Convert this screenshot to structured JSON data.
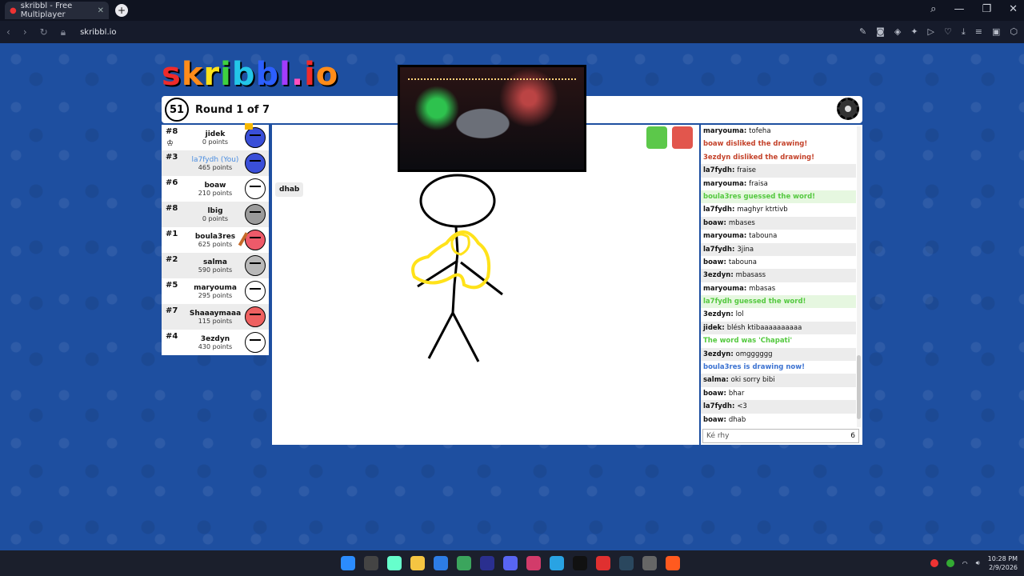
{
  "browser": {
    "tab_title": "skribbl - Free Multiplayer",
    "url": "skribbl.io",
    "new_tab": "+",
    "win_min": "—",
    "win_max": "❐",
    "win_close": "✕"
  },
  "game": {
    "logo_letters": [
      "s",
      "k",
      "r",
      "i",
      "b",
      "b",
      "l",
      ".",
      "i",
      "o"
    ],
    "timer": "51",
    "round_text": "Round 1 of 7"
  },
  "players": [
    {
      "rank": "#8",
      "name": "jidek",
      "points": "0 points",
      "color": "#3a4fd8"
    },
    {
      "rank": "#3",
      "name": "la7fydh (You)",
      "points": "465 points",
      "color": "#3a4fd8"
    },
    {
      "rank": "#6",
      "name": "boaw",
      "points": "210 points",
      "color": "#ffffff"
    },
    {
      "rank": "#8",
      "name": "lbig",
      "points": "0 points",
      "color": "#9a9a9a"
    },
    {
      "rank": "#1",
      "name": "boula3res",
      "points": "625 points",
      "color": "#ee5a6a"
    },
    {
      "rank": "#2",
      "name": "salma",
      "points": "590 points",
      "color": "#b8b8b8"
    },
    {
      "rank": "#5",
      "name": "maryouma",
      "points": "295 points",
      "color": "#ffffff"
    },
    {
      "rank": "#7",
      "name": "Shaaaymaaa",
      "points": "115 points",
      "color": "#ee6060"
    },
    {
      "rank": "#4",
      "name": "3ezdyn",
      "points": "430 points",
      "color": "#ffffff"
    }
  ],
  "bubble_text": "dhab",
  "chat": [
    {
      "user": "maryouma",
      "text": "tofeha",
      "type": "normal"
    },
    {
      "user": "",
      "text": "boaw disliked the drawing!",
      "type": "red"
    },
    {
      "user": "",
      "text": "3ezdyn disliked the drawing!",
      "type": "red"
    },
    {
      "user": "la7fydh",
      "text": "fraise",
      "type": "normal"
    },
    {
      "user": "maryouma",
      "text": "fraisa",
      "type": "normal"
    },
    {
      "user": "",
      "text": "boula3res guessed the word!",
      "type": "green"
    },
    {
      "user": "la7fydh",
      "text": "maghyr ktrtivb",
      "type": "normal"
    },
    {
      "user": "boaw",
      "text": "mbases",
      "type": "normal"
    },
    {
      "user": "maryouma",
      "text": "tabouna",
      "type": "normal"
    },
    {
      "user": "la7fydh",
      "text": "3jina",
      "type": "normal"
    },
    {
      "user": "boaw",
      "text": "tabouna",
      "type": "normal"
    },
    {
      "user": "3ezdyn",
      "text": "mbasass",
      "type": "normal"
    },
    {
      "user": "maryouma",
      "text": "mbasas",
      "type": "normal"
    },
    {
      "user": "",
      "text": "la7fydh guessed the word!",
      "type": "green"
    },
    {
      "user": "3ezdyn",
      "text": "lol",
      "type": "normal"
    },
    {
      "user": "jidek",
      "text": "blésh ktibaaaaaaaaaa",
      "type": "normal"
    },
    {
      "user": "",
      "text": "The word was 'Chapati'",
      "type": "greentext"
    },
    {
      "user": "3ezdyn",
      "text": "omgggggg",
      "type": "normal"
    },
    {
      "user": "",
      "text": "boula3res is drawing now!",
      "type": "blue"
    },
    {
      "user": "salma",
      "text": "oki sorry bibi",
      "type": "normal"
    },
    {
      "user": "boaw",
      "text": "bhar",
      "type": "normal"
    },
    {
      "user": "la7fydh",
      "text": "<3",
      "type": "normal"
    },
    {
      "user": "boaw",
      "text": "dhab",
      "type": "normal"
    }
  ],
  "chat_input": {
    "value": "Ké rhy",
    "count": "6"
  },
  "taskbar": {
    "time": "10:28 PM",
    "date": "2/9/2026",
    "icon_colors": [
      "#2b8cff",
      "#444",
      "#6fc",
      "#f5c542",
      "#2d7de6",
      "#3ba55d",
      "#2a2f8f",
      "#5865f2",
      "#d23b6a",
      "#29a3e3",
      "#111",
      "#e03030",
      "#2a475e",
      "#666",
      "#ff5a1f"
    ]
  }
}
